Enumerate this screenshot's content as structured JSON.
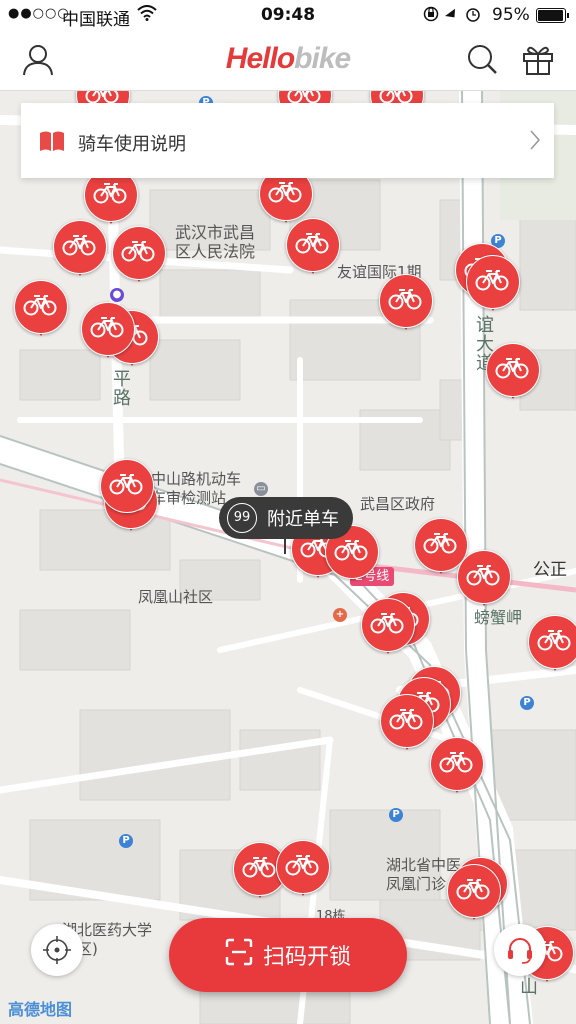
{
  "status_bar": {
    "signal": "●●○○○",
    "carrier": "中国联通",
    "wifi_icon": "wifi-icon",
    "time": "09:48",
    "battery_percent": "95%",
    "battery_level": 0.95
  },
  "nav": {
    "logo_part1": "Hello",
    "logo_part2": "bike",
    "user_icon": "user-icon",
    "search_icon": "search-icon",
    "gift_icon": "gift-icon"
  },
  "guide_card": {
    "icon": "book-icon",
    "title": "骑车使用说明"
  },
  "map_labels": {
    "court": "武汉市武昌\n区人民法院",
    "youyi": "友谊国际1期",
    "youyi_road": "谊\n大\n道",
    "ping_road": "平\n路",
    "vehicle_station": "中山路机动车\n车审检测站",
    "govt": "武昌区政府",
    "fenghuangshan": "凤凰山社区",
    "gongzheng": "公正",
    "pangxiejia": "螃蟹岬",
    "line2": "2号线",
    "hospital": "湖北省中医\n凤凰门诊",
    "university": "湖北医药大学\n校区)",
    "building18": "18栋",
    "bottom_road": "山"
  },
  "nearby": {
    "count": "99",
    "label": "附近单车"
  },
  "scan_button": {
    "icon": "scan-icon",
    "label": "扫码开锁"
  },
  "locate_icon": "locate-icon",
  "service_icon": "headset-icon",
  "map_attribution": "高德地图",
  "colors": {
    "brand_red": "#e53a3a",
    "pin_red": "#ea4040",
    "bubble_dark": "#3a3a3a",
    "poi_blue": "#3e82d6"
  }
}
